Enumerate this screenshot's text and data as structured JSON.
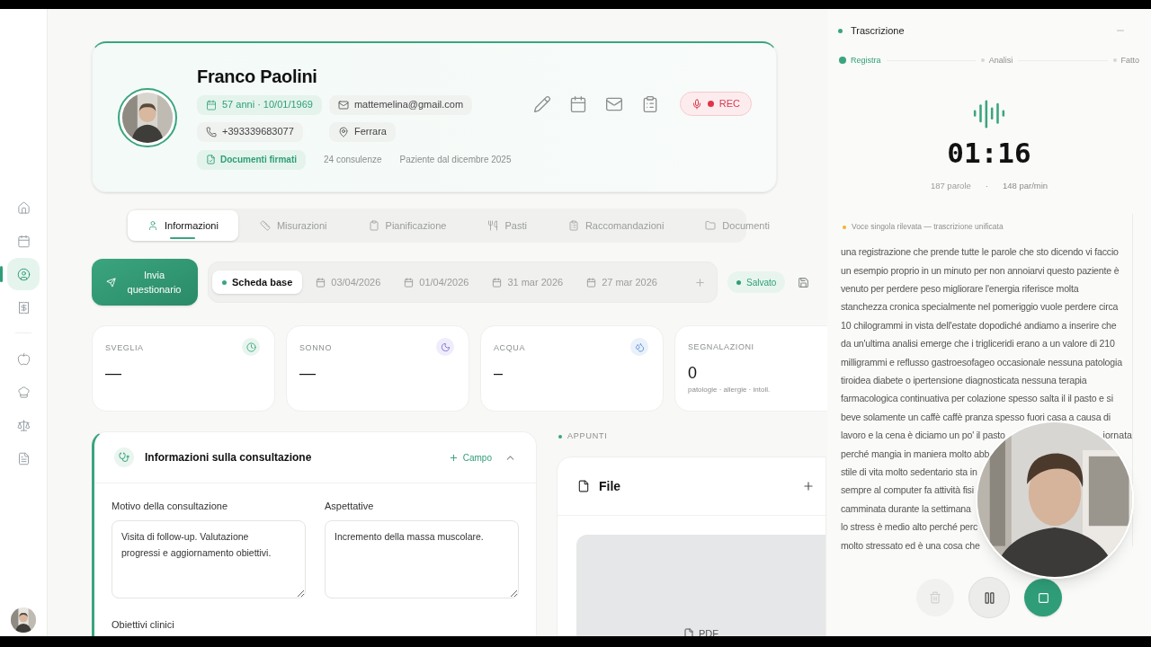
{
  "sidebar": {
    "items": [
      {
        "kind": "home",
        "selected": false
      },
      {
        "kind": "calendar",
        "selected": false
      },
      {
        "kind": "user",
        "selected": true
      },
      {
        "kind": "invoice",
        "selected": false
      },
      {
        "kind": "apple",
        "selected": false
      },
      {
        "kind": "chef",
        "selected": false
      },
      {
        "kind": "scale",
        "selected": false
      },
      {
        "kind": "document",
        "selected": false
      }
    ]
  },
  "patient": {
    "name": "Franco Paolini",
    "chips": [
      {
        "kind": "birth",
        "text": "57 anni · 10/01/1969"
      },
      {
        "kind": "email",
        "text": "mattemelina@gmail.com"
      },
      {
        "kind": "phone",
        "text": "+393339683077"
      },
      {
        "kind": "place",
        "text": "Ferrara"
      }
    ],
    "documents_badge": "Documenti firmati",
    "consultations": "24 consulenze",
    "since": "Paziente dal dicembre 2025",
    "actions": [
      {
        "kind": "edit"
      },
      {
        "kind": "calendar"
      },
      {
        "kind": "mail"
      },
      {
        "kind": "clipboard"
      }
    ],
    "rec_button": "REC"
  },
  "tabs": [
    {
      "label": "Informazioni",
      "kind": "user",
      "selected": true
    },
    {
      "label": "Misurazioni",
      "kind": "ruler",
      "selected": false
    },
    {
      "label": "Pianificazione",
      "kind": "clipboard",
      "selected": false
    },
    {
      "label": "Pasti",
      "kind": "utensils",
      "selected": false
    },
    {
      "label": "Raccomandazioni",
      "kind": "clipboard-list",
      "selected": false
    },
    {
      "label": "Documenti",
      "kind": "folder",
      "selected": false
    }
  ],
  "send_button": "Invia questionario",
  "versions": [
    {
      "label": "Scheda base",
      "kind": "base",
      "selected": true
    },
    {
      "label": "03/04/2026",
      "kind": "date",
      "selected": false
    },
    {
      "label": "01/04/2026",
      "kind": "date",
      "selected": false
    },
    {
      "label": "31 mar 2026",
      "kind": "date",
      "selected": false
    },
    {
      "label": "27 mar 2026",
      "kind": "date",
      "selected": false
    }
  ],
  "save_status": "Salvato",
  "stats": [
    {
      "label": "SVEGLIA",
      "value": "—",
      "kind": "clock"
    },
    {
      "label": "SONNO",
      "value": "—",
      "kind": "moon"
    },
    {
      "label": "ACQUA",
      "value": "–",
      "kind": "water"
    },
    {
      "label": "SEGNALAZIONI",
      "value": "0",
      "note": "patologie · allergie · intoll."
    }
  ],
  "consultation": {
    "title": "Informazioni sulla consultazione",
    "add_field": "Campo",
    "expanded": true,
    "fields": [
      {
        "label": "Motivo della consultazione",
        "value": "Visita di follow-up. Valutazione progressi e aggiornamento obiettivi."
      },
      {
        "label": "Aspettative",
        "value": "Incremento della massa muscolare."
      }
    ],
    "next_label": "Obiettivi clinici"
  },
  "notes": {
    "section": "APPUNTI",
    "file_title": "File",
    "attachment": "PDF"
  },
  "transcription": {
    "title": "Trascrizione",
    "steps": [
      {
        "label": "Registra",
        "selected": true
      },
      {
        "label": "Analisi",
        "selected": false
      },
      {
        "label": "Fatto",
        "selected": false
      }
    ],
    "timer": "01:16",
    "words": "187 parole",
    "separator": "·",
    "rate": "148 par/min",
    "notice": "Voce singola rilevata — trascrizione unificata",
    "lines": [
      {
        "left": "una registrazione che prende tutte le parole che sto dicendo vi faccio"
      },
      {
        "left": "un esempio proprio in un minuto per non annoiarvi questo paziente è"
      },
      {
        "left": "venuto per perdere peso migliorare l'energia riferisce molta"
      },
      {
        "left": "stanchezza cronica specialmente nel pomeriggio vuole perdere circa"
      },
      {
        "left": "10 chilogrammi in vista dell'estate dopodiché andiamo a inserire che"
      },
      {
        "left": "da un'ultima analisi emerge che i trigliceridi erano a un valore di 210"
      },
      {
        "left": "milligrammi e reflusso gastroesofageo occasionale nessuna patologia"
      },
      {
        "left": "tiroidea diabete o ipertensione diagnosticata nessuna terapia"
      },
      {
        "left": "farmacologica continuativa per colazione spesso salta il il pasto e si"
      },
      {
        "left": "beve solamente un caffè caffè pranza spesso fuori casa a causa di"
      },
      {
        "left": "lavoro e la cena è diciamo un po' il pasto",
        "right": "iornata"
      },
      {
        "left": "perché mangia in maniera molto abb"
      },
      {
        "left": "stile di vita molto sedentario sta in"
      },
      {
        "left": "sempre al computer fa attività fisi"
      },
      {
        "left": "camminata durante la settimana"
      },
      {
        "left": "lo stress è medio alto perché perc"
      },
      {
        "left": "molto stressato ed è una cosa che"
      }
    ],
    "controls": [
      {
        "kind": "delete",
        "disabled": true
      },
      {
        "kind": "pause",
        "disabled": false
      },
      {
        "kind": "stop",
        "disabled": false
      }
    ]
  }
}
